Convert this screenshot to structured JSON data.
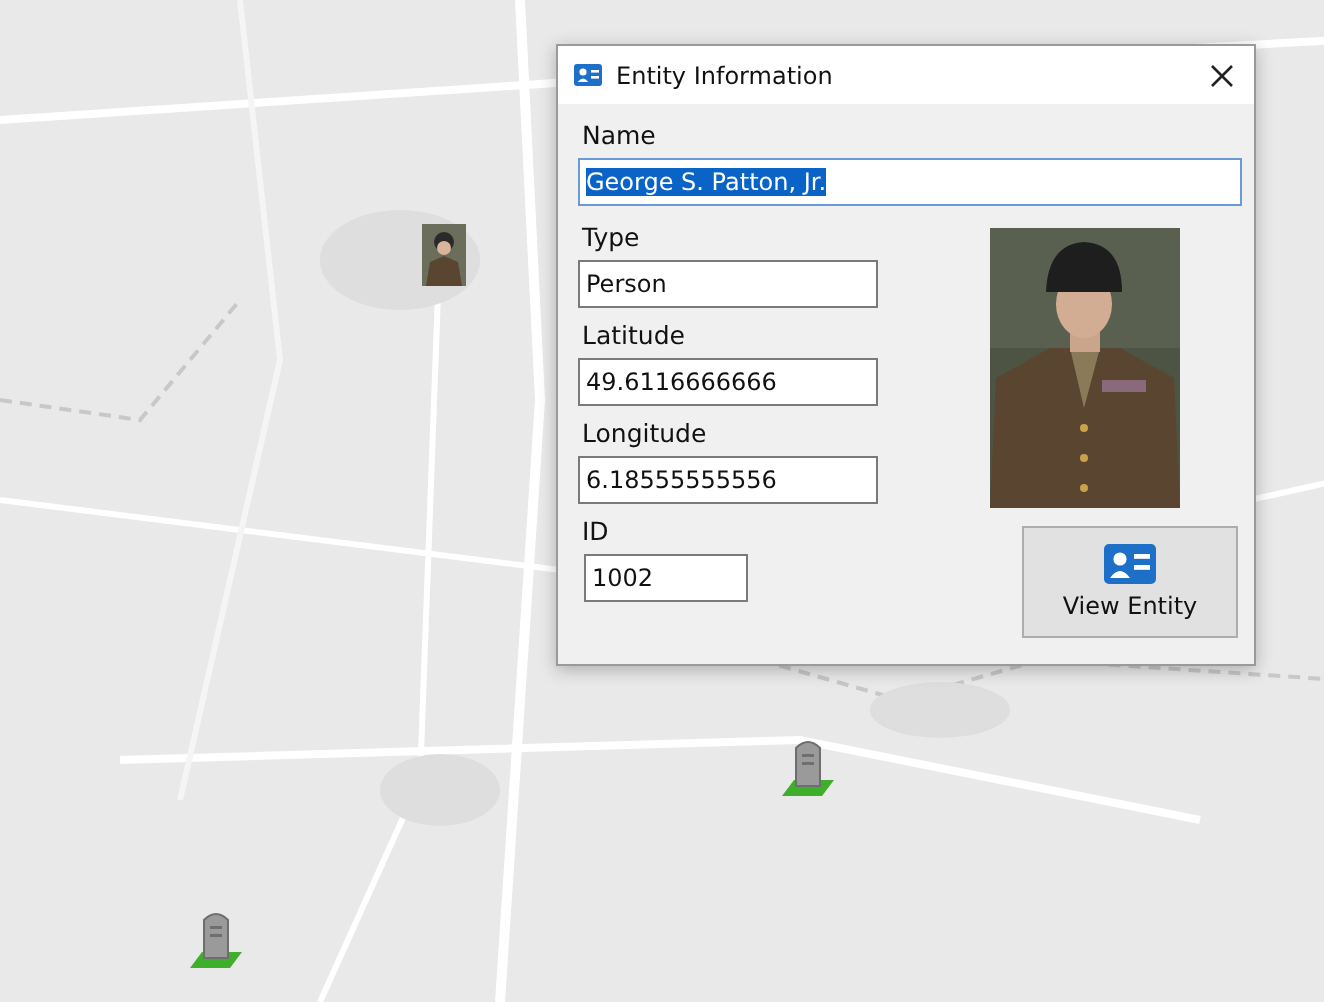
{
  "map": {
    "kind": "picture",
    "markers": [
      {
        "kind": "portrait"
      },
      {
        "kind": "grave"
      },
      {
        "kind": "grave"
      }
    ]
  },
  "dialog": {
    "title": "Entity Information",
    "fields": [
      {
        "label": "Name",
        "value": "George S. Patton, Jr.",
        "kind": "full",
        "text_selected": true
      },
      {
        "label": "Type",
        "value": "Person",
        "kind": "medium",
        "text_selected": false
      },
      {
        "label": "Latitude",
        "value": "49.6116666666",
        "kind": "medium",
        "text_selected": false
      },
      {
        "label": "Longitude",
        "value": "6.18555555556",
        "kind": "medium",
        "text_selected": false
      },
      {
        "label": "ID",
        "value": "1002",
        "kind": "small",
        "text_selected": false
      }
    ],
    "button": "View Entity"
  }
}
